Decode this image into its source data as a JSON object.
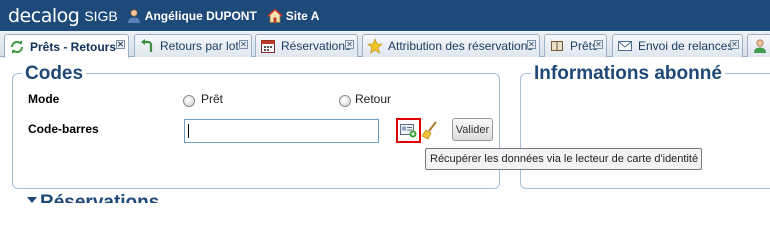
{
  "header": {
    "brand": "decalog",
    "brand_sub": "SIGB",
    "user": "Angélique DUPONT",
    "site": "Site A"
  },
  "tabs": [
    {
      "label": "Prêts - Retours",
      "icon": "refresh-icon",
      "active": true
    },
    {
      "label": "Retours par lot",
      "icon": "return-arrow-icon",
      "active": false
    },
    {
      "label": "Réservations",
      "icon": "calendar-icon",
      "active": false
    },
    {
      "label": "Attribution des réservations",
      "icon": "star-icon",
      "active": false
    },
    {
      "label": "Prêts",
      "icon": "book-icon",
      "active": false
    },
    {
      "label": "Envoi de relances",
      "icon": "envelope-icon",
      "active": false
    },
    {
      "label": "",
      "icon": "user-icon",
      "active": false
    }
  ],
  "codes": {
    "legend": "Codes",
    "mode_label": "Mode",
    "mode_options": [
      "Prêt",
      "Retour"
    ],
    "barcode_label": "Code-barres",
    "barcode_value": "",
    "validate_label": "Valider",
    "scan_tooltip": "Récupérer les données via le lecteur de carte d'identité"
  },
  "subscriber": {
    "legend": "Informations abonné"
  },
  "next_section": {
    "label": "Réservations"
  },
  "colors": {
    "topbar": "#1e4a7a",
    "legend": "#1d4877",
    "highlight": "#e00000"
  }
}
